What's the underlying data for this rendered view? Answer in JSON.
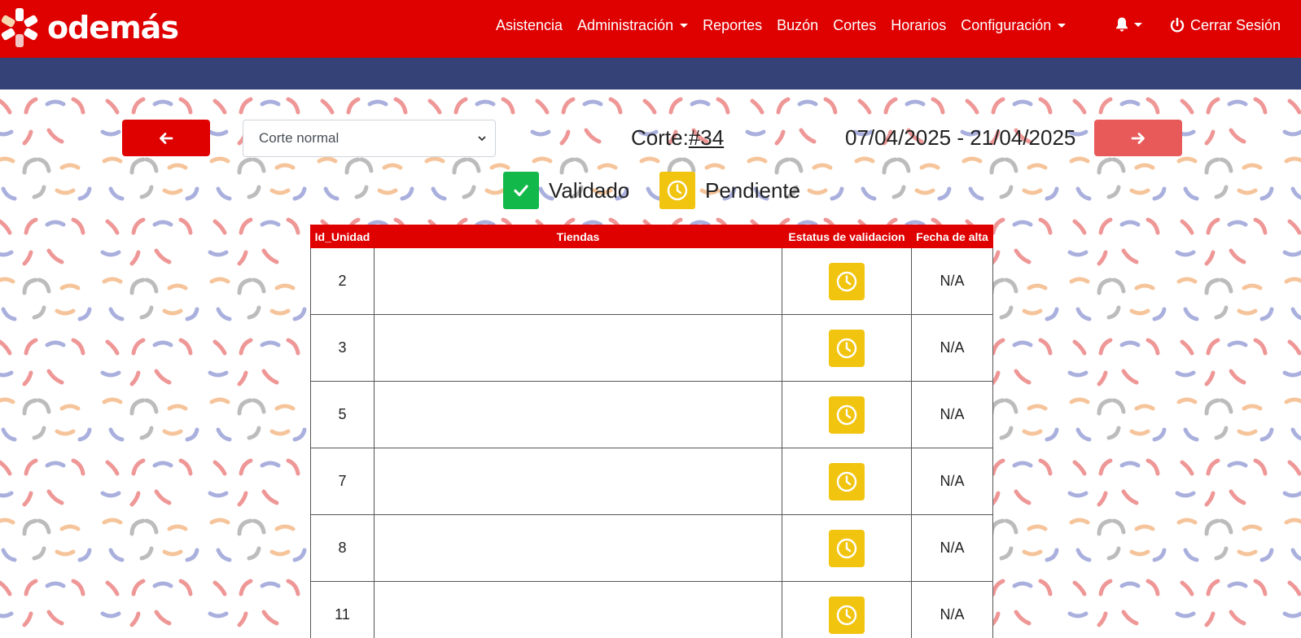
{
  "brand": {
    "name": "odemás"
  },
  "nav": {
    "items": [
      {
        "label": "Asistencia",
        "dropdown": false
      },
      {
        "label": "Administración",
        "dropdown": true
      },
      {
        "label": "Reportes",
        "dropdown": false
      },
      {
        "label": "Buzón",
        "dropdown": false
      },
      {
        "label": "Cortes",
        "dropdown": false
      },
      {
        "label": "Horarios",
        "dropdown": false
      },
      {
        "label": "Configuración",
        "dropdown": true
      }
    ],
    "logout_label": "Cerrar Sesión"
  },
  "colors": {
    "primary_red": "#df0000",
    "subbar_navy": "#344277",
    "next_button": "#e85a5a",
    "validated_green": "#12b84a",
    "pending_yellow": "#f1c40f"
  },
  "toolbar": {
    "prev_icon": "arrow-left-icon",
    "next_icon": "arrow-right-icon",
    "select_value": "Corte normal",
    "corte_label": "Corte:",
    "corte_number": "#34",
    "date_range": "07/04/2025 - 21/04/2025"
  },
  "legend": {
    "validated": "Validado",
    "pending": "Pendiente"
  },
  "table": {
    "headers": [
      "Id_Unidad",
      "Tiendas",
      "Estatus de validacion",
      "Fecha de alta"
    ],
    "rows": [
      {
        "id": "2",
        "tienda": "",
        "status": "pending",
        "fecha": "N/A"
      },
      {
        "id": "3",
        "tienda": "",
        "status": "pending",
        "fecha": "N/A"
      },
      {
        "id": "5",
        "tienda": "",
        "status": "pending",
        "fecha": "N/A"
      },
      {
        "id": "7",
        "tienda": "",
        "status": "pending",
        "fecha": "N/A"
      },
      {
        "id": "8",
        "tienda": "",
        "status": "pending",
        "fecha": "N/A"
      },
      {
        "id": "11",
        "tienda": "",
        "status": "pending",
        "fecha": "N/A"
      }
    ]
  }
}
